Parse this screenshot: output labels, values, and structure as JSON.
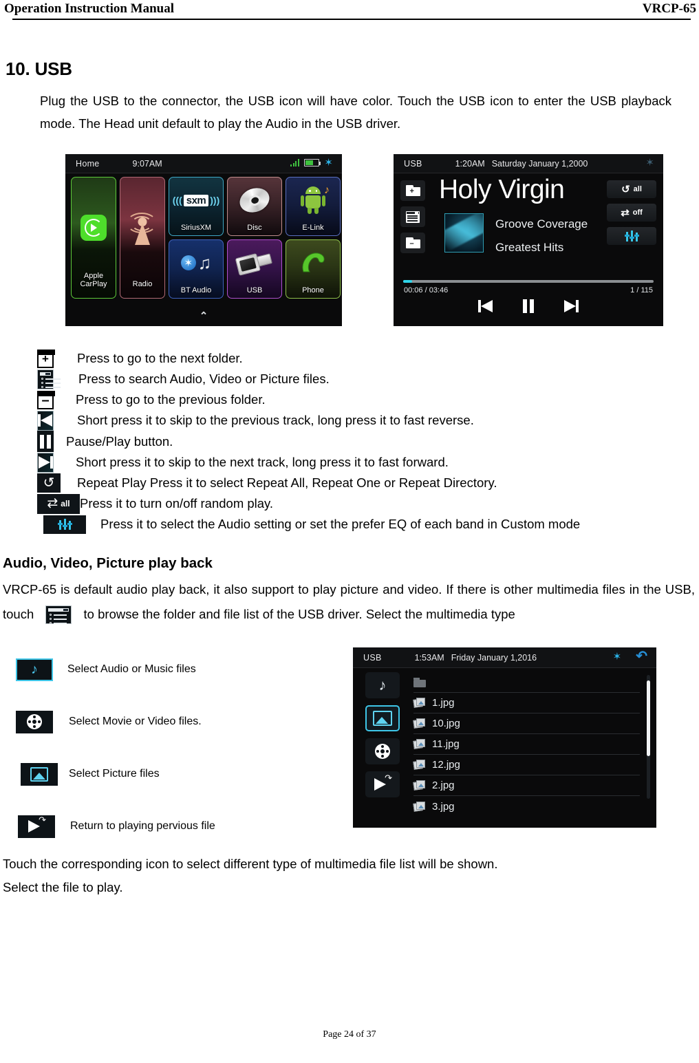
{
  "header": {
    "left": "Operation Instruction Manual",
    "right": "VRCP-65"
  },
  "section": {
    "number_title": "10. USB",
    "intro": "Plug the USB to the connector, the USB icon will have color. Touch the USB icon to enter the USB playback mode. The Head unit default to play the Audio in the USB driver."
  },
  "home_screen": {
    "status": {
      "label": "Home",
      "time": "9:07AM"
    },
    "icons": {
      "signal": "signal-bars-icon",
      "battery": "battery-icon",
      "bluetooth": "bluetooth-icon"
    },
    "tiles": [
      {
        "label": "Apple\nCarPlay",
        "name": "tile-apple-carplay",
        "accent": "#5ecb3a"
      },
      {
        "label": "Radio",
        "name": "tile-radio",
        "accent": "#b06a74"
      },
      {
        "label": "SiriusXM",
        "name": "tile-siriusxm",
        "accent": "#3ea8c6"
      },
      {
        "label": "Disc",
        "name": "tile-disc",
        "accent": "#c08d8d"
      },
      {
        "label": "E-Link",
        "name": "tile-elink",
        "accent": "#5a6fc0"
      },
      {
        "label": "BT Audio",
        "name": "tile-bt-audio",
        "accent": "#3f62bf"
      },
      {
        "label": "USB",
        "name": "tile-usb",
        "accent": "#b050d0"
      },
      {
        "label": "Phone",
        "name": "tile-phone",
        "accent": "#8fc24a"
      }
    ],
    "carplay_label_line1": "Apple",
    "carplay_label_line2": "CarPlay",
    "sxm_text": "sxm",
    "chevron": "⌃"
  },
  "player_screen": {
    "status": {
      "source": "USB",
      "time": "1:20AM",
      "date": "Saturday January 1,2000"
    },
    "track_title": "Holy Virgin",
    "artist": "Groove Coverage",
    "album": "Greatest Hits",
    "elapsed_total": "00:06 / 03:46",
    "track_count": "1 / 115",
    "repeat_mode": "all",
    "shuffle_mode": "off",
    "progress_percent": 3.5,
    "buttons": {
      "next_folder": "folder-plus-icon",
      "browse": "file-list-icon",
      "prev_folder": "folder-minus-icon",
      "prev_track": "previous-track-icon",
      "pause": "pause-icon",
      "next_track": "next-track-icon",
      "repeat": "repeat-icon",
      "shuffle": "shuffle-icon",
      "eq": "equalizer-icon"
    }
  },
  "legend": [
    {
      "icon": "folder-plus-icon",
      "text": "Press to go to the next folder."
    },
    {
      "icon": "file-list-icon",
      "text": "Press to search Audio, Video or Picture files."
    },
    {
      "icon": "folder-minus-icon",
      "text": "Press to go to the previous folder."
    },
    {
      "icon": "previous-track-icon",
      "text": "Short press it to skip to the previous track, long press it to fast reverse."
    },
    {
      "icon": "pause-icon",
      "text": "Pause/Play button."
    },
    {
      "icon": "next-track-icon",
      "text": "Short press it to skip to the next track, long press it to fast forward."
    },
    {
      "icon": "repeat-icon",
      "text": "Repeat Play Press it to select Repeat All, Repeat One or Repeat Directory."
    },
    {
      "icon": "shuffle-icon",
      "text": "Press it to turn on/off random play.",
      "icon_label": "all"
    },
    {
      "icon": "equalizer-icon",
      "text": "Press it to select the Audio setting or set the prefer EQ of each band in Custom mode"
    }
  ],
  "playback_section": {
    "heading": "Audio, Video, Picture play back",
    "para_part1": "VRCP-65 is default audio play back, it also support to play picture and video. If there is other multimedia files in the USB, touch",
    "para_part2": "to browse the folder and file list of the USB driver. Select the multimedia type",
    "inline_icon": "file-list-icon"
  },
  "type_legend": [
    {
      "icon": "music-note-icon",
      "text": "Select Audio or Music files",
      "selected": true
    },
    {
      "icon": "film-reel-icon",
      "text": "Select Movie or Video files.",
      "selected": false
    },
    {
      "icon": "picture-icon",
      "text": "Select Picture files",
      "selected": false
    },
    {
      "icon": "return-play-icon",
      "text": "Return to playing pervious file",
      "selected": false
    }
  ],
  "browser_screen": {
    "status": {
      "source": "USB",
      "time": "1:53AM",
      "date": "Friday January 1,2016"
    },
    "icons": {
      "bluetooth": "bluetooth-icon",
      "back": "back-arrow-icon"
    },
    "sidebar": [
      {
        "icon": "music-note-icon",
        "selected": false
      },
      {
        "icon": "picture-icon",
        "selected": true
      },
      {
        "icon": "film-reel-icon",
        "selected": false
      },
      {
        "icon": "return-play-icon",
        "selected": false
      }
    ],
    "files": [
      {
        "name": "",
        "type": "folder"
      },
      {
        "name": "1.jpg",
        "type": "image"
      },
      {
        "name": "10.jpg",
        "type": "image"
      },
      {
        "name": "11.jpg",
        "type": "image"
      },
      {
        "name": "12.jpg",
        "type": "image"
      },
      {
        "name": "2.jpg",
        "type": "image"
      },
      {
        "name": "3.jpg",
        "type": "image"
      }
    ]
  },
  "closing": {
    "line1": "Touch the corresponding icon to select different type of multimedia file list will be shown.",
    "line2": "Select the file to play."
  },
  "footer": "Page 24 of 37"
}
